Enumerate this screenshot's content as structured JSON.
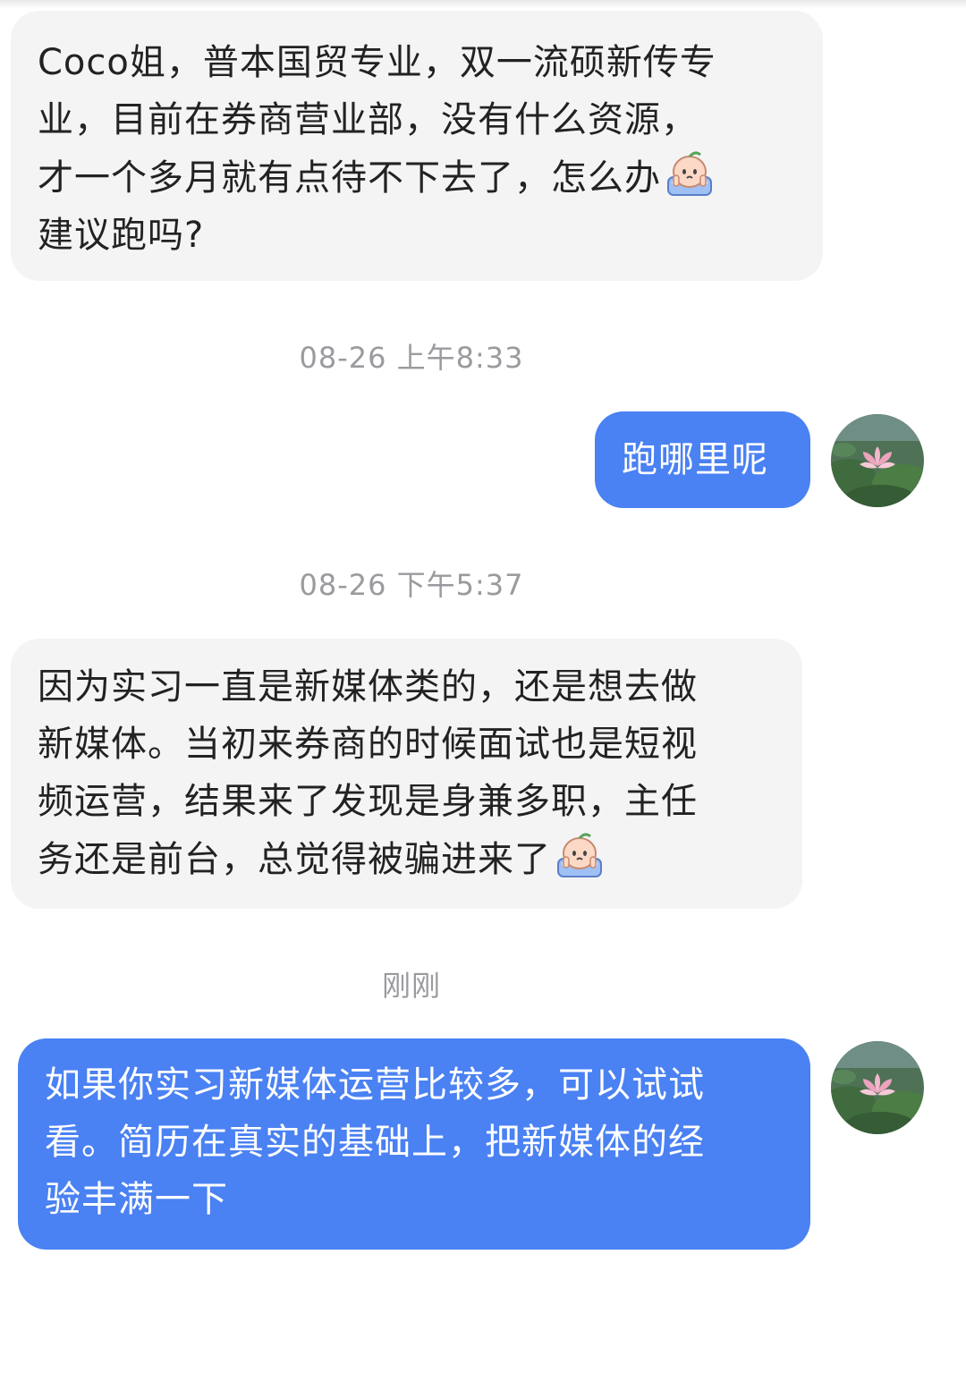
{
  "conversation": {
    "messages": [
      {
        "id": "m1",
        "from": "contact",
        "lines": [
          "Coco姐，普本国贸专业，双一流硕新传专",
          "业，目前在券商营业部，没有什么资源，",
          "才一个多月就有点待不下去了，怎么办",
          "建议跑吗?"
        ],
        "emoji": "crying-peach-emoji"
      },
      {
        "id": "t1",
        "timestamp": "08-26 上午8:33"
      },
      {
        "id": "m2",
        "from": "me",
        "lines": [
          "跑哪里呢"
        ]
      },
      {
        "id": "t2",
        "timestamp": "08-26 下午5:37"
      },
      {
        "id": "m3",
        "from": "contact",
        "lines": [
          "因为实习一直是新媒体类的，还是想去做",
          "新媒体。当初来券商的时候面试也是短视",
          "频运营，结果来了发现是身兼多职，主任",
          "务还是前台，总觉得被骗进来了"
        ],
        "emoji": "crying-peach-emoji"
      },
      {
        "id": "t3",
        "timestamp": "刚刚"
      },
      {
        "id": "m4",
        "from": "me",
        "lines": [
          "如果你实习新媒体运营比较多，可以试试",
          "看。简历在真实的基础上，把新媒体的经",
          "验丰满一下"
        ]
      }
    ]
  },
  "colors": {
    "incoming_bubble": "#f4f4f5",
    "outgoing_bubble": "#4a81f3",
    "timestamp_text": "#9a9a9f"
  },
  "avatar": {
    "icon": "lotus-flower-avatar-icon"
  }
}
